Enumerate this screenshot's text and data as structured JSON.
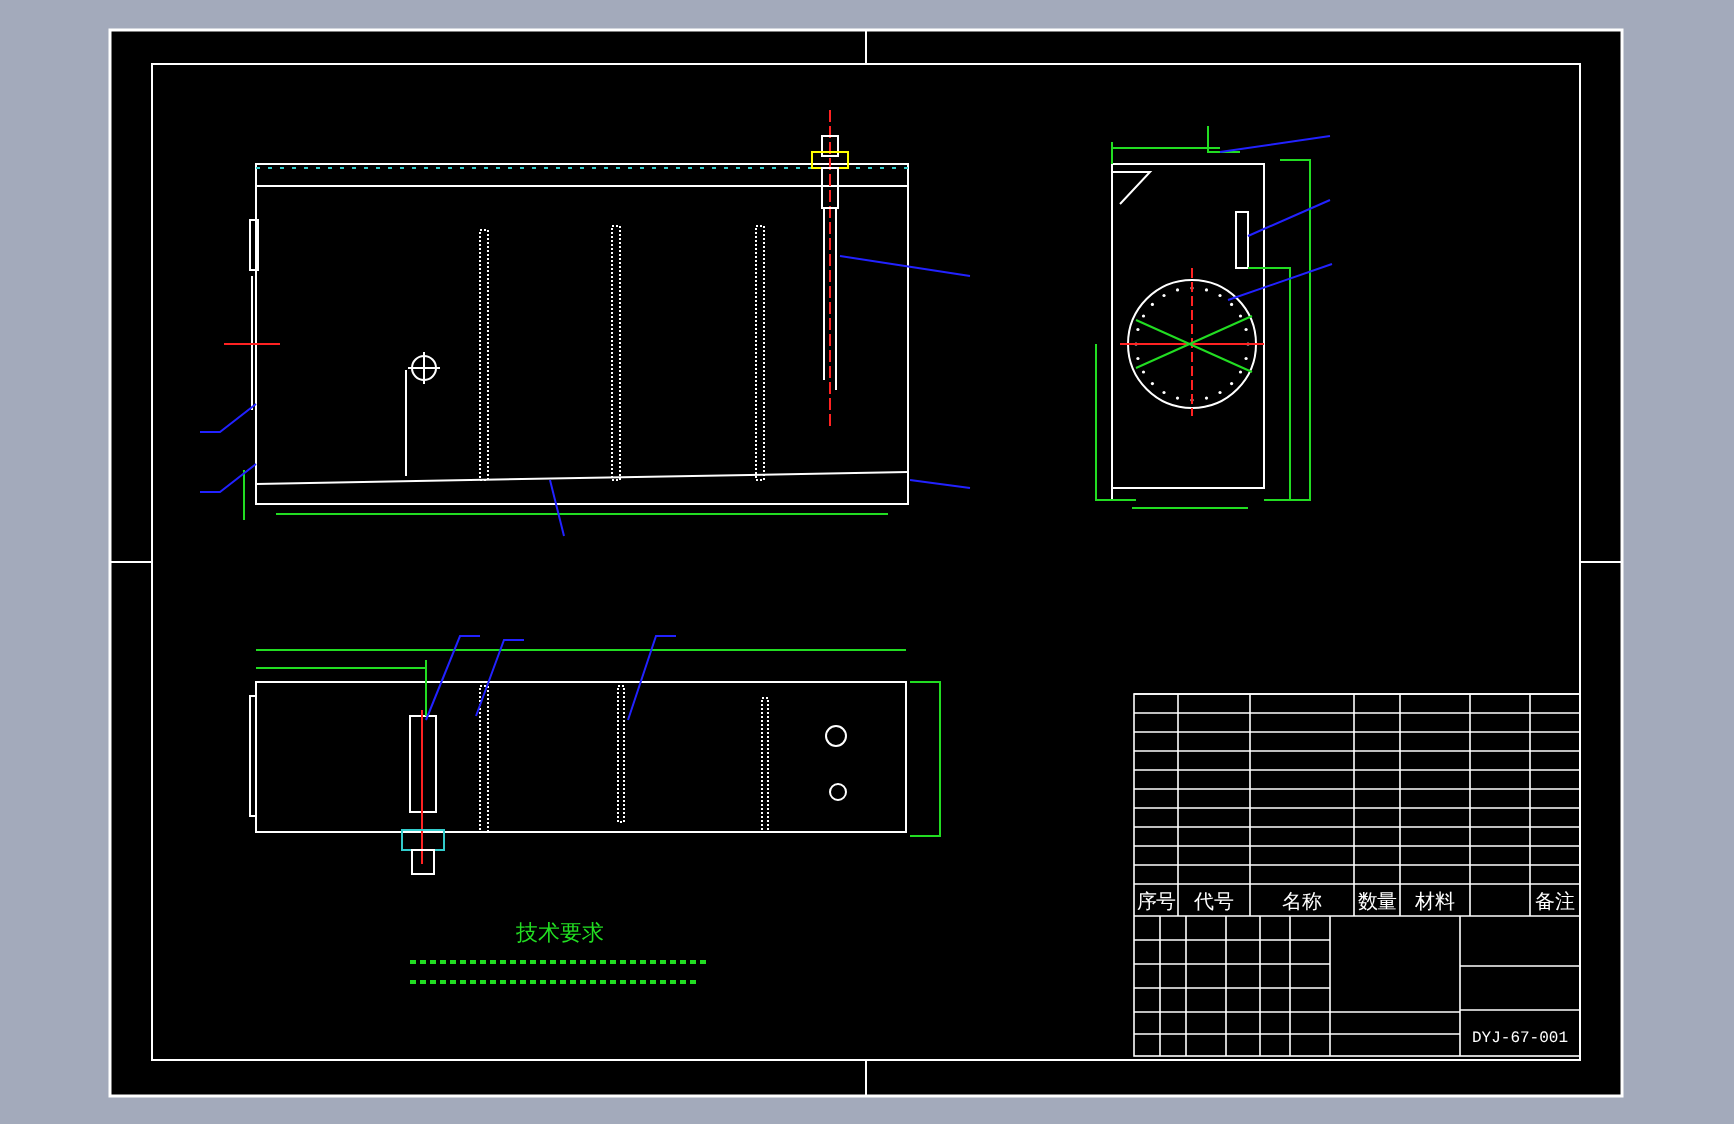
{
  "technical_requirements": {
    "title": "技术要求"
  },
  "parts_list": {
    "headers": [
      {
        "label": "序号",
        "kind": "narrow"
      },
      {
        "label": "代号",
        "kind": "wide"
      },
      {
        "label": "名称",
        "kind": "wide"
      },
      {
        "label": "数量",
        "kind": "narrow"
      },
      {
        "label": "材料",
        "kind": "wide"
      },
      {
        "label": "备注",
        "kind": "wide"
      }
    ]
  },
  "title_block": {
    "drawing_number": "DYJ-67-001"
  }
}
